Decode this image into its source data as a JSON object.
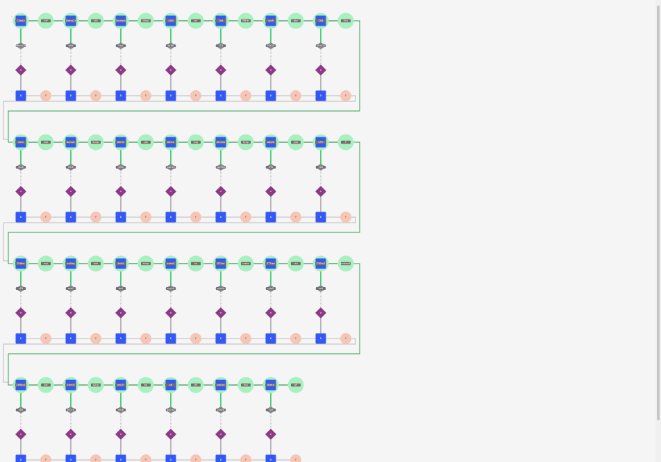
{
  "colors": {
    "backbone": "#2e9e55",
    "node_ring": "#a8f0c0",
    "square": "#3358f4",
    "brown": "#7a6b66",
    "diamond_gray": "#8a8a8e",
    "purple": "#8b3a86",
    "peach": "#f5c6b6",
    "link_gray": "#a9a9a9",
    "background": "#f5f5f5"
  },
  "rows": [
    {
      "top": [
        "CEeSx",
        "luP",
        "EkevsZr",
        "ulA",
        "EbcrwzV",
        "cbxp",
        "ZXB",
        "ec",
        "TAB",
        "RBrtr",
        "lvoP",
        "gty",
        "TAB",
        "Ecu"
      ],
      "gray": [
        "dbmrGA",
        "rtfdl",
        "EwA",
        "bcRB",
        "vTB",
        "vTeGk",
        "vEwGa"
      ],
      "square_label": "B",
      "peach_label": "P",
      "index_left": "3"
    },
    {
      "top": [
        "zxcs",
        "Evp",
        "Ares2c",
        "Evep",
        "AEre2",
        "ulp",
        "AErc2",
        "Evp",
        "AErexo",
        "Rrep",
        "aXp5i",
        "yxe",
        "aPG",
        "P"
      ],
      "gray": [
        "rxoB",
        "rxDE",
        "rxDA",
        "yopre1",
        "rxpeBn",
        "ETA",
        "vaA"
      ],
      "square_label": "B",
      "peach_label": "P",
      "index_left": ""
    },
    {
      "top": [
        "ZHBre",
        "erp",
        "aoSeq",
        "exe",
        "AnPd",
        "exop",
        "eneoS",
        "np",
        "DTEre",
        "rxere",
        "ZTTren",
        "rax",
        "ZTBro2",
        "exepe1"
      ],
      "gray": [
        "vEB",
        "dxbS",
        "dxA",
        "ryq0A",
        "vyb0A",
        "rytaB",
        "vnA"
      ],
      "square_label": "B",
      "peach_label": "P",
      "index_left": ""
    },
    {
      "top": [
        "ZHBrx1",
        "ow",
        "EhreD",
        "aZrp",
        "ozcZr",
        "ea",
        "aR",
        "aP",
        "boclrp",
        "ecy",
        "Bretb",
        "aP"
      ],
      "gray": [
        "vEB",
        "eZrcp",
        "eezB",
        "anpre2",
        "vxeZB",
        "vUA"
      ],
      "square_label": "B",
      "peach_label": "P",
      "index_left": ""
    }
  ]
}
